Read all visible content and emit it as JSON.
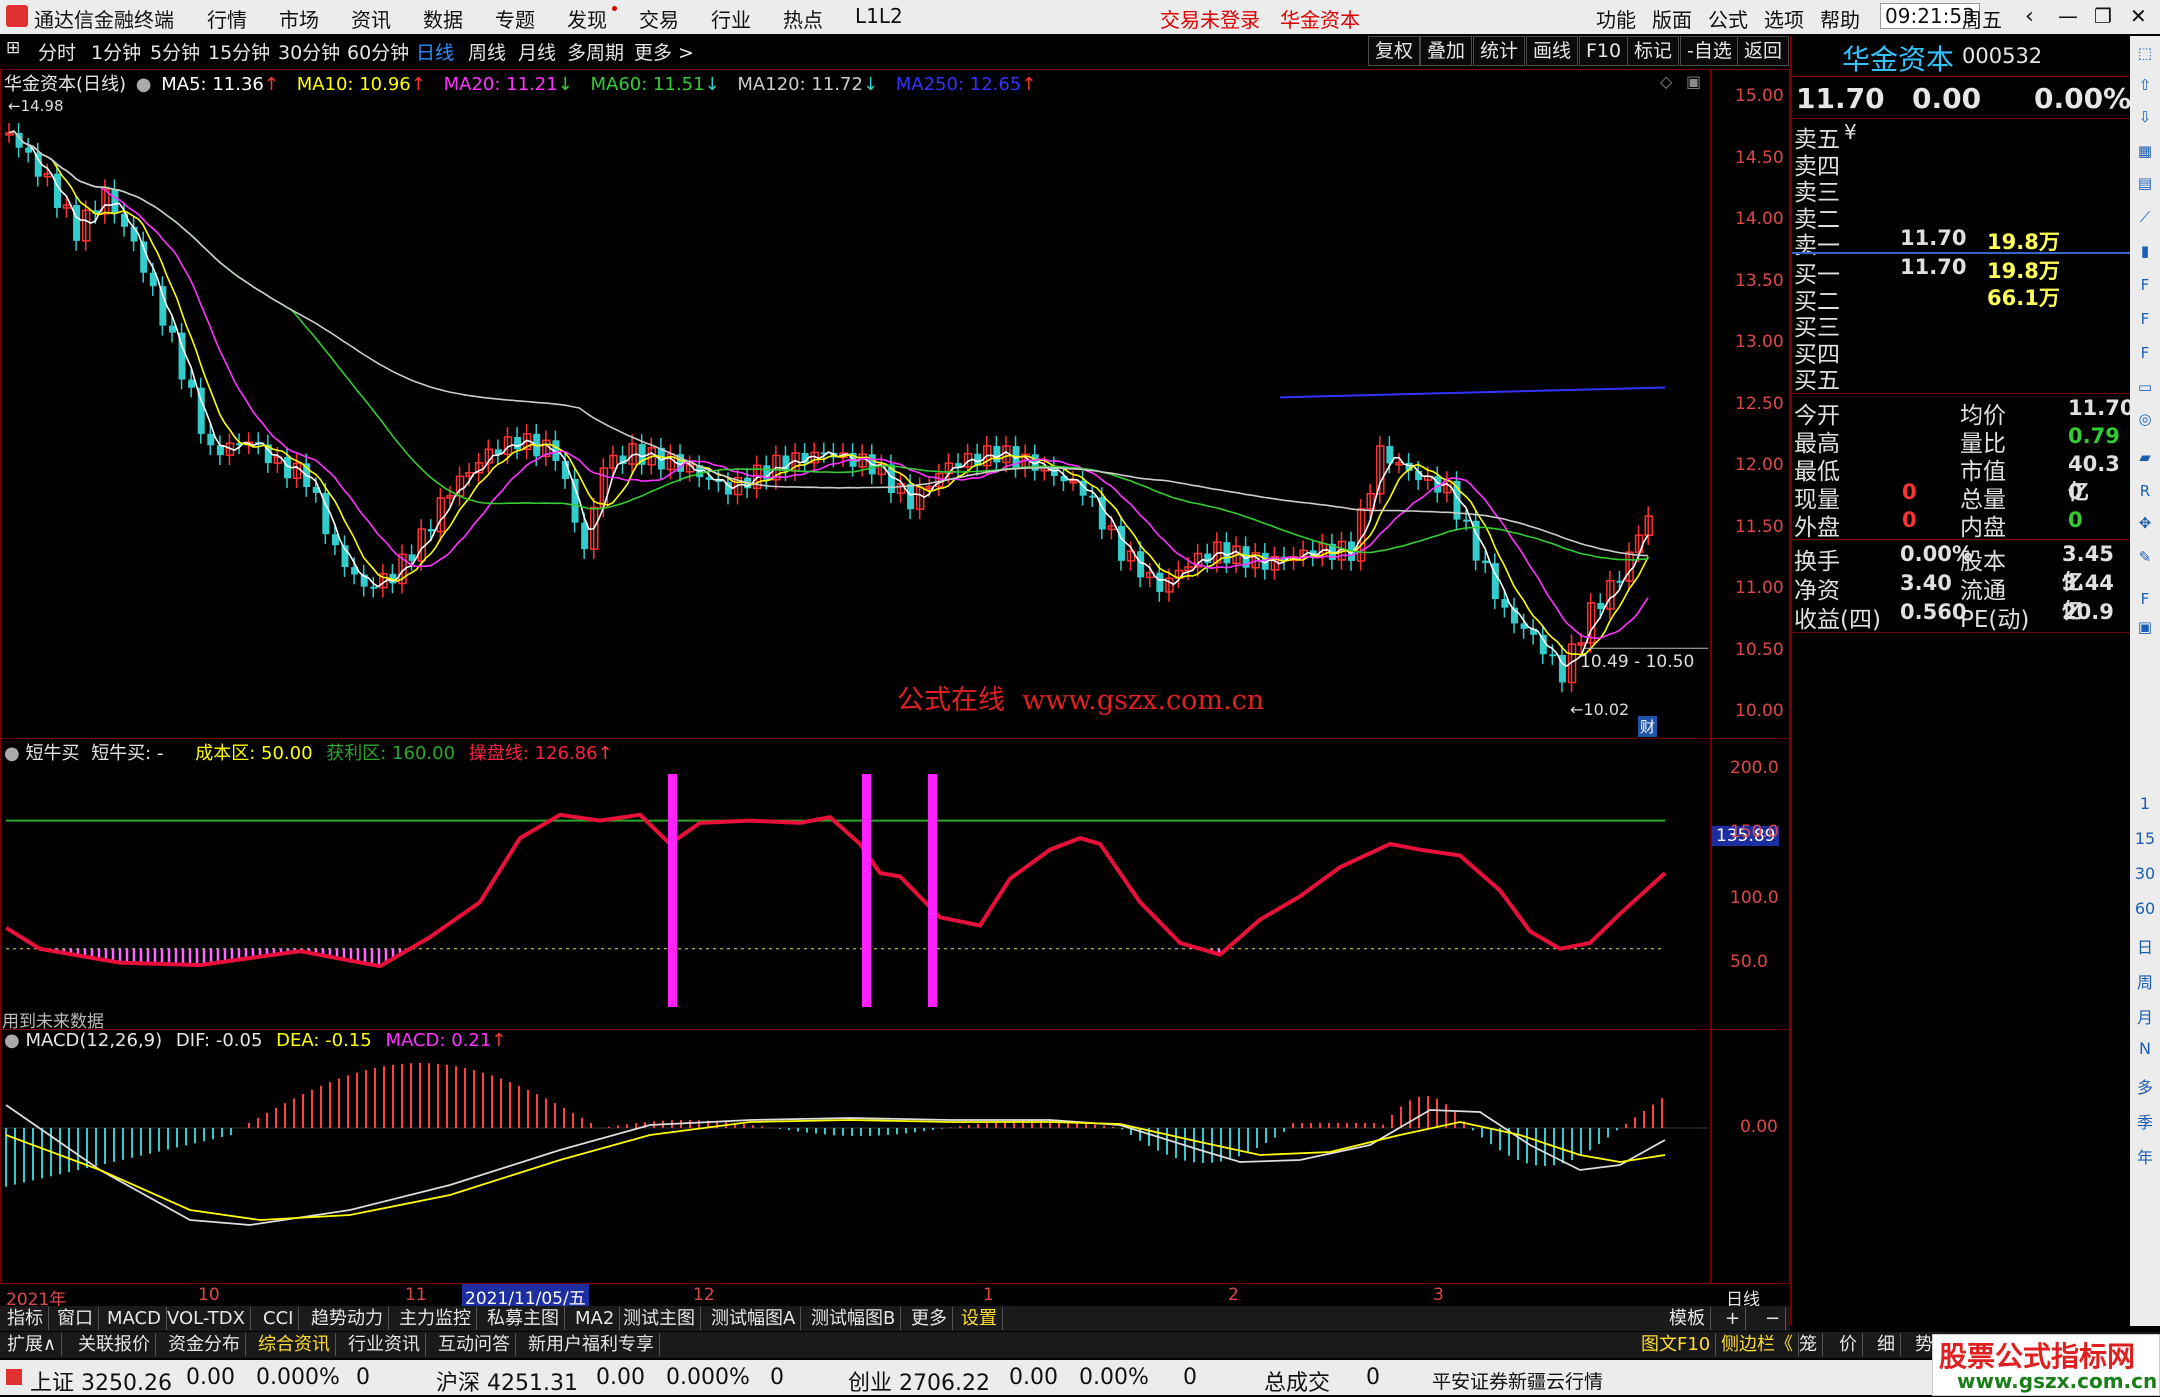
{
  "titlebar": {
    "app_name": "通达信金融终端",
    "menus": [
      "行情",
      "市场",
      "资讯",
      "数据",
      "专题",
      "发现",
      "交易",
      "行业",
      "热点",
      "L1L2"
    ],
    "trade_login": "交易未登录",
    "stock_name": "华金资本",
    "right_menus": [
      "功能",
      "版面",
      "公式",
      "选项",
      "帮助"
    ],
    "time": "09:21:53",
    "weekday": "周五"
  },
  "periods": [
    "分时",
    "1分钟",
    "5分钟",
    "15分钟",
    "30分钟",
    "60分钟",
    "日线",
    "周线",
    "月线",
    "多周期",
    "更多 >"
  ],
  "active_period": "日线",
  "toolbar_right": [
    "复权",
    "叠加",
    "统计",
    "画线",
    "F10",
    "标记",
    "-自选",
    "返回"
  ],
  "main_chart": {
    "title": "华金资本(日线)",
    "ma": [
      {
        "label": "MA5: 11.36",
        "arrow": "↑",
        "color": "#ffffff"
      },
      {
        "label": "MA10: 10.96",
        "arrow": "↑",
        "color": "#ffff00"
      },
      {
        "label": "MA20: 11.21",
        "arrow": "↓",
        "color": "#ff33ff"
      },
      {
        "label": "MA60: 11.51",
        "arrow": "↓",
        "color": "#33cc33"
      },
      {
        "label": "MA120: 11.72",
        "arrow": "↓",
        "color": "#cccccc"
      },
      {
        "label": "MA250: 12.65",
        "arrow": "↑",
        "color": "#3333ff"
      }
    ],
    "high_marker": "14.98",
    "low_marker": "10.02",
    "range_label": "10.49 - 10.50",
    "cai_badge": "财",
    "watermark": "公式在线  www.gszx.com.cn",
    "y_labels": [
      "15.00",
      "14.50",
      "14.00",
      "13.50",
      "13.00",
      "12.50",
      "12.00",
      "11.50",
      "11.00",
      "10.50",
      "10.00"
    ]
  },
  "indicator": {
    "name": "短牛买",
    "title_value": "短牛买: -",
    "cost_zone": "成本区: 50.00",
    "profit_zone": "获利区: 160.00",
    "control_line": "操盘线: 126.86",
    "current_value": "135.89",
    "future_note": "用到未来数据",
    "y_labels": [
      "200.0",
      "150.0",
      "100.0",
      "50.0"
    ]
  },
  "macd": {
    "name": "MACD(12,26,9)",
    "dif": "DIF: -0.05",
    "dea": "DEA: -0.15",
    "macd": "MACD: 0.21",
    "zero_label": "0.00"
  },
  "xaxis": {
    "labels": [
      "2021年",
      "10",
      "11",
      "2021/11/05/五",
      "12",
      "1",
      "2",
      "3"
    ],
    "period_label": "日线"
  },
  "quote": {
    "name": "华金资本",
    "code": "000532",
    "price": "11.70",
    "change": "0.00",
    "change_pct": "0.00%",
    "sells": [
      {
        "label": "卖五",
        "price": "",
        "vol": "",
        "extra": "¥"
      },
      {
        "label": "卖四",
        "price": "",
        "vol": ""
      },
      {
        "label": "卖三",
        "price": "",
        "vol": ""
      },
      {
        "label": "卖二",
        "price": "",
        "vol": ""
      },
      {
        "label": "卖一",
        "price": "11.70",
        "vol": "19.8万"
      }
    ],
    "buys": [
      {
        "label": "买一",
        "price": "11.70",
        "vol": "19.8万"
      },
      {
        "label": "买二",
        "price": "",
        "vol": "66.1万"
      },
      {
        "label": "买三",
        "price": "",
        "vol": ""
      },
      {
        "label": "买四",
        "price": "",
        "vol": ""
      },
      {
        "label": "买五",
        "price": "",
        "vol": ""
      }
    ],
    "stats": [
      {
        "l1": "今开",
        "v1": "",
        "l2": "均价",
        "v2": "11.70",
        "c2": "#e0e0e0"
      },
      {
        "l1": "最高",
        "v1": "",
        "l2": "量比",
        "v2": "0.79",
        "c2": "#33cc33"
      },
      {
        "l1": "最低",
        "v1": "",
        "l2": "市值",
        "v2": "40.3亿",
        "c2": "#e0e0e0"
      },
      {
        "l1": "现量",
        "v1": "0",
        "l2": "总量",
        "v2": "0",
        "c2": "#e0e0e0",
        "c1": "#ff3333"
      },
      {
        "l1": "外盘",
        "v1": "0",
        "l2": "内盘",
        "v2": "0",
        "c2": "#33cc33",
        "c1": "#ff3333"
      }
    ],
    "fund": [
      {
        "l1": "换手",
        "v1": "0.00%",
        "l2": "股本",
        "v2": "3.45亿"
      },
      {
        "l1": "净资",
        "v1": "3.40",
        "l2": "流通",
        "v2": "3.44亿"
      },
      {
        "l1": "收益(四)",
        "v1": "0.560",
        "l2": "PE(动)",
        "v2": "20.9"
      }
    ]
  },
  "sidebar_labels": [
    "1",
    "15",
    "30",
    "60",
    "日",
    "周",
    "月",
    "N",
    "多",
    "季",
    "年"
  ],
  "tabs_row1": [
    "指标",
    "窗口",
    "MACD",
    "VOL-TDX",
    "CCI",
    "趋势动力",
    "主力监控",
    "私募主图",
    "MA2",
    "测试主图",
    "测试幅图A",
    "测试幅图B",
    "更多",
    "设置"
  ],
  "tabs_row1_right": [
    "模板",
    "+",
    "−"
  ],
  "tabs_row2": [
    "扩展∧",
    "关联报价",
    "资金分布",
    "综合资讯",
    "行业资讯",
    "互动问答",
    "新用户福利专享"
  ],
  "tabs_row2_right": [
    "图文F10",
    "侧边栏《",
    "笼",
    "价",
    "细",
    "势"
  ],
  "statusbar": {
    "items": [
      {
        "name": "上证",
        "value": "3250.26",
        "chg": "0.00",
        "pct": "0.000%",
        "vol": "0"
      },
      {
        "name": "沪深",
        "value": "4251.31",
        "chg": "0.00",
        "pct": "0.000%",
        "vol": "0"
      },
      {
        "name": "创业",
        "value": "2706.22",
        "chg": "0.00",
        "pct": "0.00%",
        "vol": "0"
      }
    ],
    "total_label": "总成交",
    "total_value": "0",
    "broker": "平安证券新疆云行情"
  },
  "brand_watermark": {
    "line1": "股票公式指标网",
    "line2": "www.gszx.com.cn"
  },
  "colors": {
    "up": "#ff3333",
    "down": "#33cccc",
    "accent": "#2f8dff",
    "border": "#7a0000"
  }
}
